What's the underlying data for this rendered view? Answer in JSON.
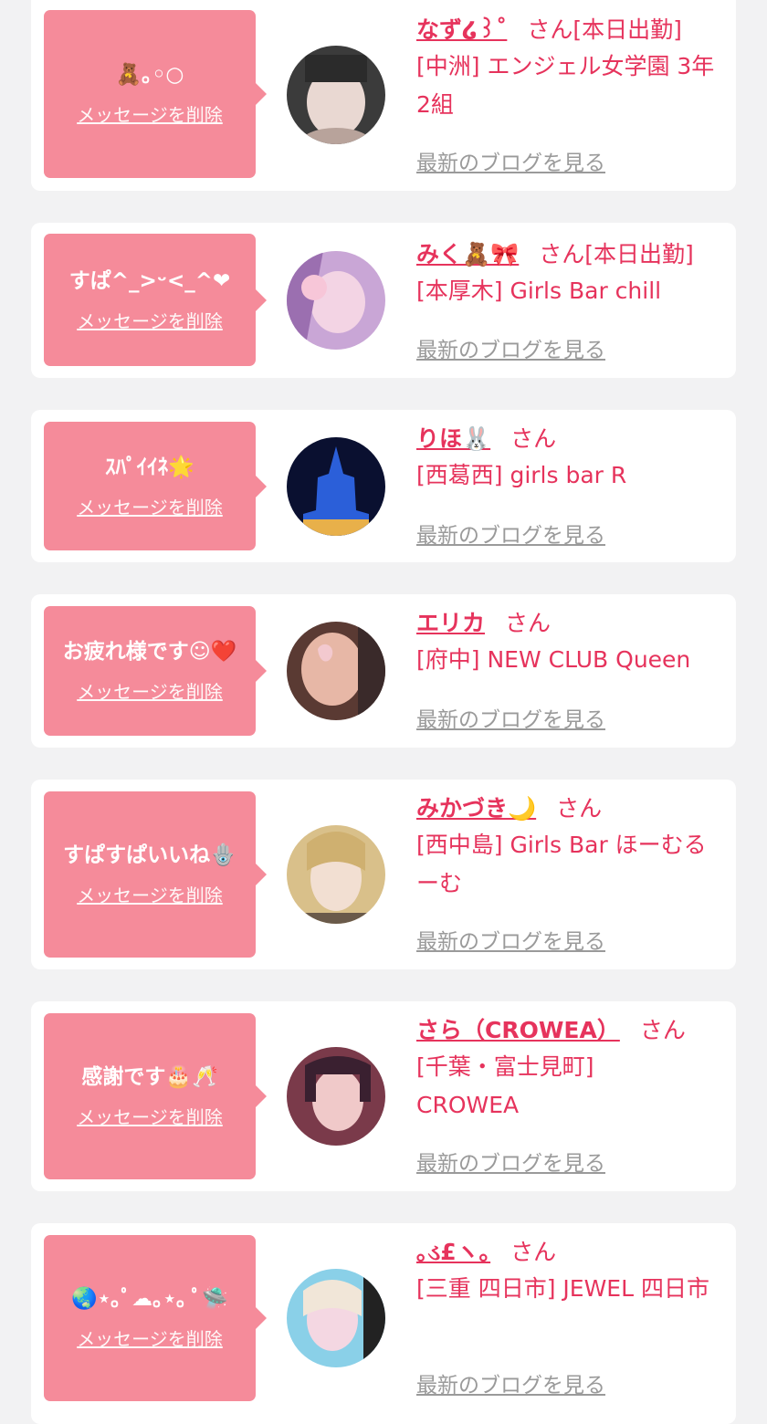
{
  "entries": [
    {
      "message": "🧸｡◦○",
      "delete_label": "メッセージを削除",
      "name": "なず໒꒱˚",
      "suffix": "さん",
      "status": "[本日出勤]",
      "shop": "[中洲] エンジェル女学園 3年2組",
      "blog_label": "最新のブログを見る",
      "avatar_colors": [
        "#3b3b3b",
        "#e9d8d2",
        "#b8a39b"
      ]
    },
    {
      "message": "すぱ^_>ᵕ<_^❤",
      "delete_label": "メッセージを削除",
      "name": "みく🧸🎀",
      "suffix": "さん",
      "status": "[本日出勤]",
      "shop": "[本厚木] Girls Bar chill",
      "blog_label": "最新のブログを見る",
      "avatar_colors": [
        "#c9a6d6",
        "#f3d4e4",
        "#9b6fb0"
      ]
    },
    {
      "message": "ｽﾊﾟｲｲﾈ🌟",
      "delete_label": "メッセージを削除",
      "name": "りほ🐰",
      "suffix": "さん",
      "status": "",
      "shop": "[西葛西] girls bar R",
      "blog_label": "最新のブログを見る",
      "avatar_colors": [
        "#0a1030",
        "#2b5fd9",
        "#e8b04a"
      ]
    },
    {
      "message": "お疲れ様です☺︎❤️",
      "delete_label": "メッセージを削除",
      "name": "エリカ",
      "suffix": "さん",
      "status": "",
      "shop": "[府中] NEW CLUB Queen",
      "blog_label": "最新のブログを見る",
      "avatar_colors": [
        "#5a3a33",
        "#e7b7a6",
        "#3a2a2a"
      ]
    },
    {
      "message": "すぱすぱいいね🪬",
      "delete_label": "メッセージを削除",
      "name": "みかづき🌙",
      "suffix": "さん",
      "status": "",
      "shop": "[西中島] Girls Bar ほーむるーむ",
      "blog_label": "最新のブログを見る",
      "avatar_colors": [
        "#d9c08a",
        "#f2dfd2",
        "#6a5a4a"
      ]
    },
    {
      "message": "感謝です🎂🥂",
      "delete_label": "メッセージを削除",
      "name": "さら（CROWEA）",
      "suffix": "さん",
      "status": "",
      "shop": "[千葉・富士見町] CROWEA",
      "blog_label": "最新のブログを見る",
      "avatar_colors": [
        "#7a3a4a",
        "#f0c9c9",
        "#3a2030"
      ]
    },
    {
      "message": "🌏⋆｡ﾟ☁︎｡⋆｡ ﾟ🛸",
      "delete_label": "メッセージを削除",
      "name": "｡ડ£ヽ｡",
      "suffix": "さん",
      "status": "",
      "shop": "[三重 四日市] JEWEL 四日市",
      "blog_label": "最新のブログを見る",
      "avatar_colors": [
        "#8ad0e8",
        "#f4d7e2",
        "#222222"
      ]
    }
  ]
}
